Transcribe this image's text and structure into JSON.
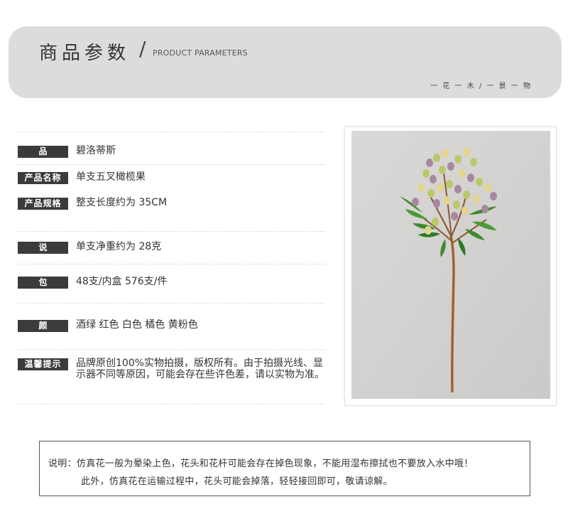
{
  "header": {
    "title": "商品参数",
    "slash": "/",
    "subtitle": "PRODUCT PARAMETERS",
    "motto": "一 花 一 木 / 一 景 一 物"
  },
  "params": [
    {
      "label": "品  牌",
      "value": "碧洛蒂斯"
    },
    {
      "label": "产品名称",
      "value": "单支五叉橄榄果"
    },
    {
      "label": "产品规格",
      "value": "整支长度约为 35CM"
    },
    {
      "label": "说  明",
      "value": "单支净重约为 28克"
    },
    {
      "label": "包  装",
      "value": "48支/内盒 576支/件"
    },
    {
      "label": "颜  色",
      "value": "酒绿 红色 白色 橘色 黄粉色"
    },
    {
      "label": "温馨提示",
      "value": "品牌原创100%实物拍摄，版权所有。由于拍摄光线、显示器不同等原因，可能会存在些许色差，请以实物为准。"
    }
  ],
  "note": {
    "line1": "说明：仿真花一般为晕染上色，花头和花杆可能会存在掉色现象，不能用湿布擦拭也不要放入水中哦！",
    "line2": "此外，仿真花在运输过程中，花头可能会掉落，轻轻接回即可，敬请谅解。"
  },
  "colors": {
    "banner_bg": "#dcdcdc",
    "tag_bg": "#3b3b3b",
    "photo_bg": "#d4d3d1",
    "stem": "#a0612f",
    "leaf": "#3f8a2e",
    "berry_green": "#b9c96a",
    "berry_purple": "#a689a0",
    "berry_cream": "#e3d58e"
  },
  "icons": {
    "product_photo": "olive-branch-photo"
  }
}
